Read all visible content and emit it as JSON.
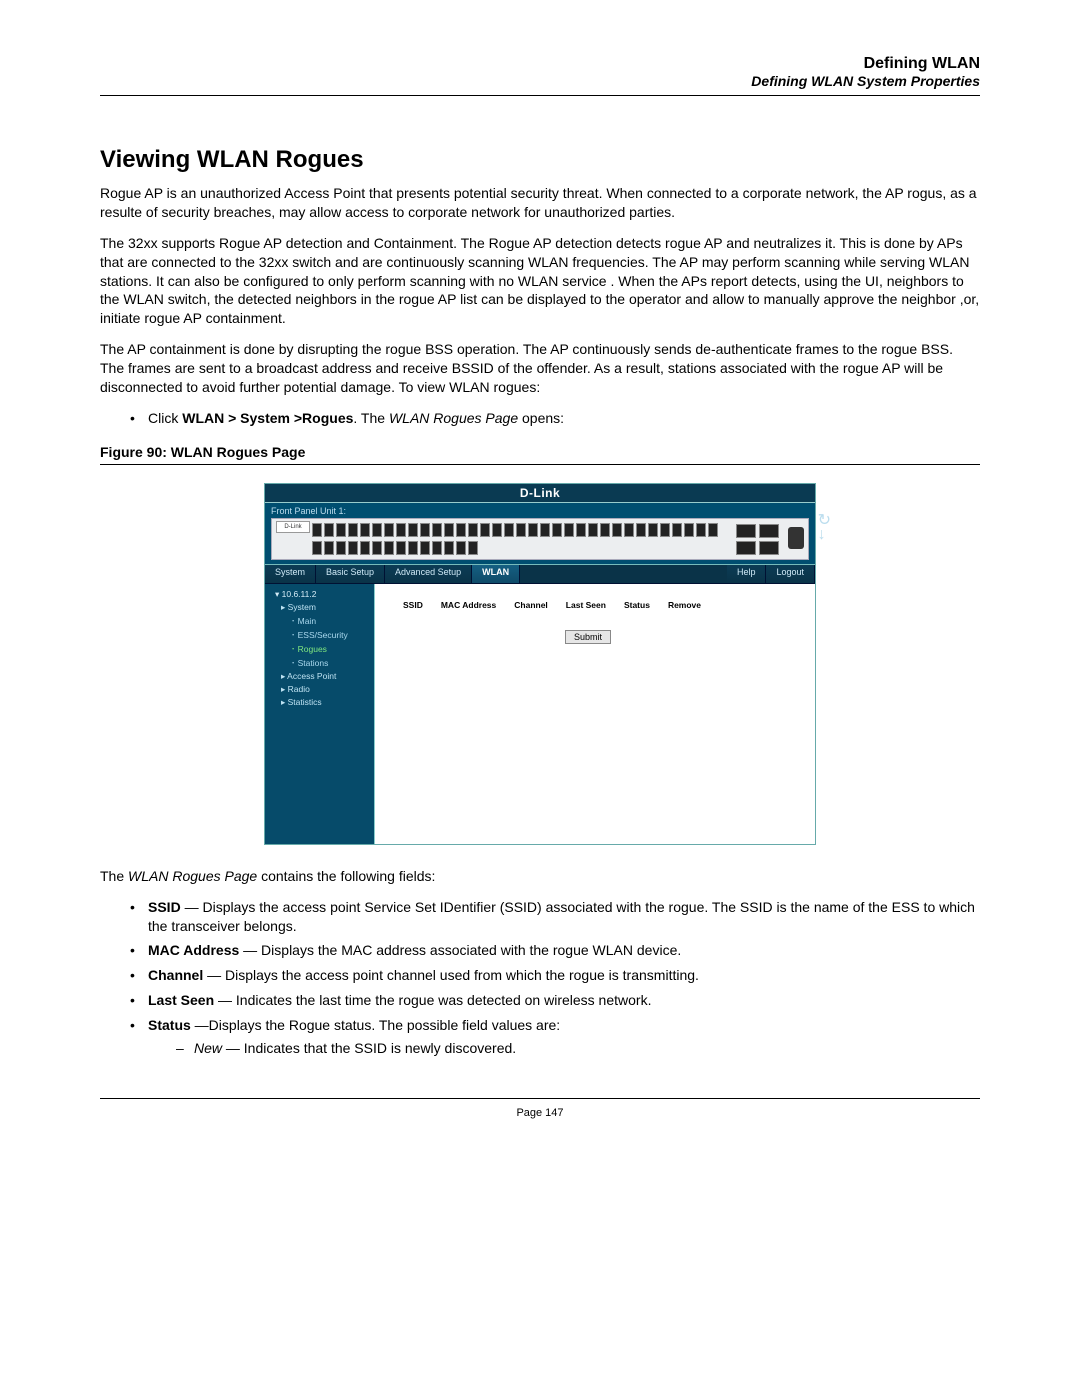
{
  "header": {
    "title": "Defining WLAN",
    "subtitle": "Defining WLAN System Properties"
  },
  "section_title": "Viewing WLAN Rogues",
  "paragraphs": {
    "p1": "Rogue AP is an unauthorized Access Point that presents potential security threat. When connected to a corporate network, the AP rogus, as a resulte of security breaches, may allow access to corporate network for unauthorized parties.",
    "p2": "The 32xx supports Rogue AP detection and Containment. The Rogue AP detection detects rogue AP and neutralizes it. This is done by APs that are connected to the 32xx switch and are continuously scanning WLAN frequencies. The AP may perform scanning while serving WLAN stations. It can also be configured to only perform scanning with no WLAN service . When the APs report detects, using the UI, neighbors to the WLAN switch, the detected neighbors in the rogue AP list can be displayed to the operator and allow to manually approve the neighbor ,or, initiate rogue AP containment.",
    "p3": "The AP containment is done by disrupting the rogue BSS operation. The AP continuously sends de-authenticate frames to the rogue BSS. The frames are sent to a broadcast address and receive BSSID of the offender. As a result, stations associated with the rogue AP will be disconnected to avoid further potential damage. To view WLAN rogues:"
  },
  "nav_instruction": {
    "prefix": "Click ",
    "path": "WLAN > System >Rogues",
    "middle": ".  The ",
    "page_name": "WLAN Rogues Page",
    "suffix": " opens:"
  },
  "figure_caption": "Figure 90:  WLAN Rogues Page",
  "screenshot": {
    "brand": "D-Link",
    "panel_label": "Front Panel Unit 1:",
    "device_label": "D-Link",
    "tabs": {
      "system": "System",
      "basic": "Basic Setup",
      "advanced": "Advanced Setup",
      "wlan": "WLAN",
      "help": "Help",
      "logout": "Logout"
    },
    "tree": {
      "root": "10.6.11.2",
      "system": "System",
      "main": "Main",
      "ess": "ESS/Security",
      "rogues": "Rogues",
      "stations": "Stations",
      "ap": "Access Point",
      "radio": "Radio",
      "stats": "Statistics"
    },
    "columns": {
      "ssid": "SSID",
      "mac": "MAC Address",
      "channel": "Channel",
      "last_seen": "Last Seen",
      "status": "Status",
      "remove": "Remove"
    },
    "submit": "Submit"
  },
  "after_figure_intro": {
    "prefix": "The ",
    "page_name": "WLAN Rogues Page",
    "suffix": " contains the following fields:"
  },
  "fields": {
    "ssid": {
      "label": "SSID",
      "desc": " — Displays the access point Service Set IDentifier (SSID) associated with the rogue. The SSID is the name of the ESS to which the transceiver belongs."
    },
    "mac": {
      "label": "MAC Address",
      "desc": " — Displays the MAC address associated with the rogue WLAN device."
    },
    "channel": {
      "label": "Channel",
      "desc": " — Displays the access point channel used from which the rogue is transmitting."
    },
    "last_seen": {
      "label": "Last Seen",
      "desc": " — Indicates the last time the rogue was detected on wireless network."
    },
    "status": {
      "label": "Status",
      "desc": " —Displays the Rogue status. The possible field values are:",
      "sub": {
        "new_label": "New",
        "new_desc": " — Indicates that the SSID is newly discovered."
      }
    }
  },
  "footer": "Page 147"
}
